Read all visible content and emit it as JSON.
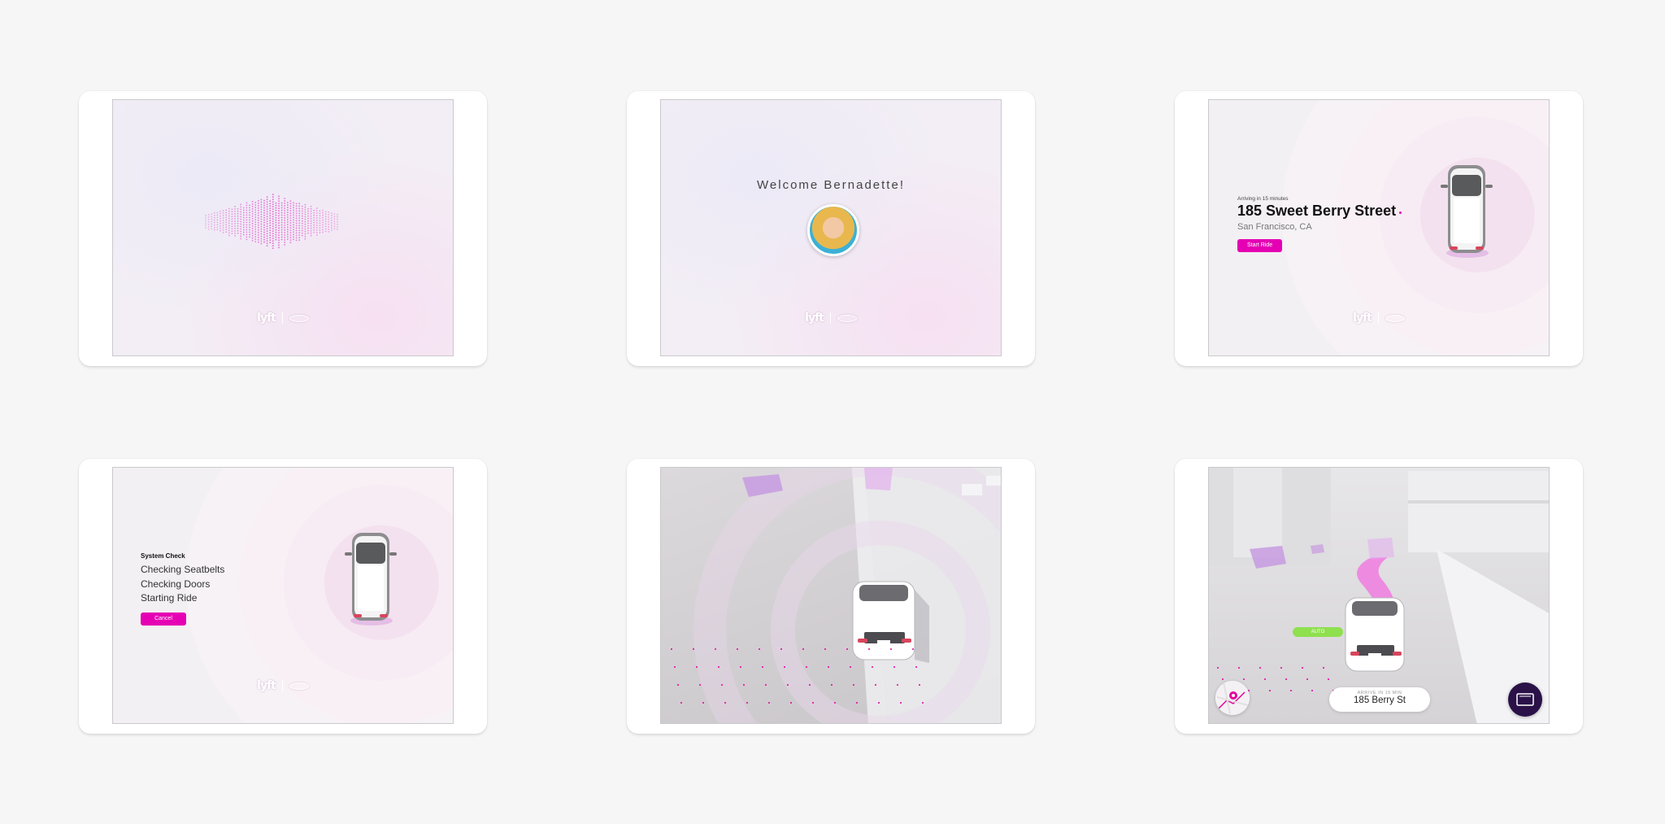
{
  "brand": {
    "logo_text": "lyft"
  },
  "screens": {
    "welcome": {
      "greeting": "Welcome Bernadette!"
    },
    "arrival": {
      "arriving_label": "Arriving in 15 minutes",
      "street": "185 Sweet Berry Street",
      "city": "San Francisco, CA",
      "start_button": "Start Ride"
    },
    "system_check": {
      "title": "System Check",
      "lines": [
        "Checking Seatbelts",
        "Checking Doors",
        "Starting Ride"
      ],
      "cancel_button": "Cancel"
    },
    "ride": {
      "mode_badge": "AUTO",
      "arrive_label": "ARRIVE IN 15 MIN",
      "destination": "185 Berry St"
    }
  },
  "icons": [
    "listening-wave-icon",
    "map-icon",
    "screen-icon"
  ],
  "colors": {
    "accent": "#e500b3",
    "auto_badge": "#8fe04f",
    "screen_button": "#2a1248",
    "background": "#f6f6f6"
  }
}
